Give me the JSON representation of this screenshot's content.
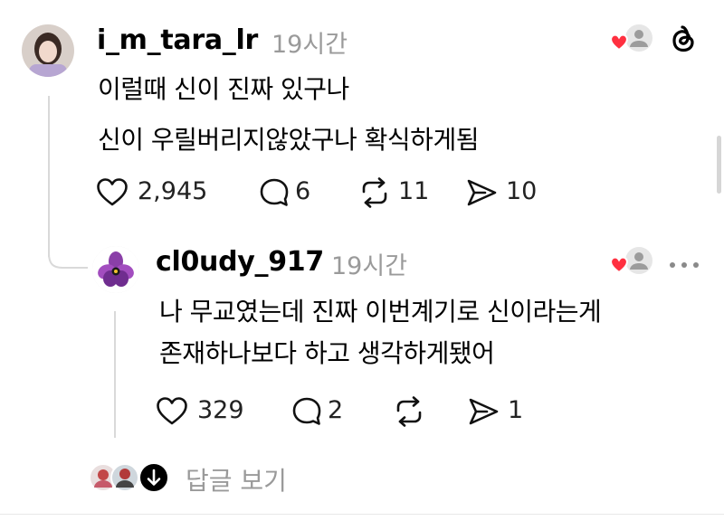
{
  "post": {
    "username": "i_m_tara_lr",
    "time": "19시간",
    "lines": [
      "이럴때 신이 진짜 있구나",
      "신이 우릴버리지않았구나 확식하게됨"
    ],
    "likes": "2,945",
    "comments": "6",
    "reposts": "11",
    "shares": "10"
  },
  "reply": {
    "username": "cl0udy_917",
    "time": "19시간",
    "lines": [
      "나 무교였는데 진짜 이번계기로 신이라는게",
      "존재하나보다 하고 생각하게됐어"
    ],
    "likes": "329",
    "comments": "2",
    "reposts": "",
    "shares": "1"
  },
  "footer": {
    "view_replies": "답글 보기"
  },
  "icons": {
    "like": "heart-outline-icon",
    "comment": "speech-bubble-icon",
    "repost": "repost-arrows-icon",
    "share": "send-arrow-icon",
    "liked_by_author": "heart-with-avatar-icon",
    "app": "threads-logo-icon",
    "more": "more-dots-icon",
    "expand": "arrow-down-icon"
  },
  "colors": {
    "heart": "#ff3040",
    "muted": "#9a9a9a"
  }
}
